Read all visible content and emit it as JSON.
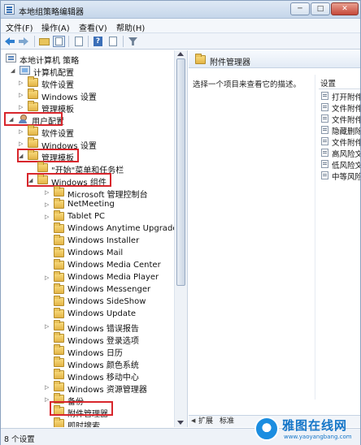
{
  "window": {
    "title": "本地组策略编辑器",
    "minimize_glyph": "─",
    "maximize_glyph": "□",
    "close_glyph": "✕"
  },
  "menu": [
    "文件(F)",
    "操作(A)",
    "查看(V)",
    "帮助(H)"
  ],
  "toolbar": {
    "icons": [
      "back-arrow-icon",
      "forward-arrow-icon",
      "up-folder-icon",
      "show-tree-icon",
      "export-list-icon",
      "help-icon",
      "properties-icon",
      "filter-icon"
    ]
  },
  "tree": {
    "root": "本地计算机 策略",
    "computer_config": "计算机配置",
    "cc_software": "软件设置",
    "cc_windows": "Windows 设置",
    "cc_admin": "管理模板",
    "user_config": "用户配置",
    "uc_software": "软件设置",
    "uc_windows": "Windows 设置",
    "uc_admin": "管理模板",
    "start_menu": "\"开始\"菜单和任务栏",
    "windows_components": "Windows 组件",
    "components": [
      "Microsoft 管理控制台",
      "NetMeeting",
      "Tablet PC",
      "Windows Anytime Upgrade",
      "Windows Installer",
      "Windows Mail",
      "Windows Media Center",
      "Windows Media Player",
      "Windows Messenger",
      "Windows SideShow",
      "Windows Update",
      "Windows 错误报告",
      "Windows 登录选项",
      "Windows 日历",
      "Windows 颜色系统",
      "Windows 移动中心",
      "Windows 资源管理器",
      "备份",
      "附件管理器",
      "即时搜索"
    ]
  },
  "right": {
    "header_title": "附件管理器",
    "description": "选择一个项目来查看它的描述。",
    "settings_label": "设置",
    "settings": [
      "打开附件",
      "文件附件",
      "文件附件",
      "隐藏删除",
      "文件附件",
      "高风险文",
      "低风险文",
      "中等风险"
    ],
    "tabs": [
      "扩展",
      "标准"
    ]
  },
  "status": {
    "text": "8 个设置"
  },
  "watermark": {
    "title": "雅图在线网",
    "url": "www.yaoyangbang.com"
  }
}
